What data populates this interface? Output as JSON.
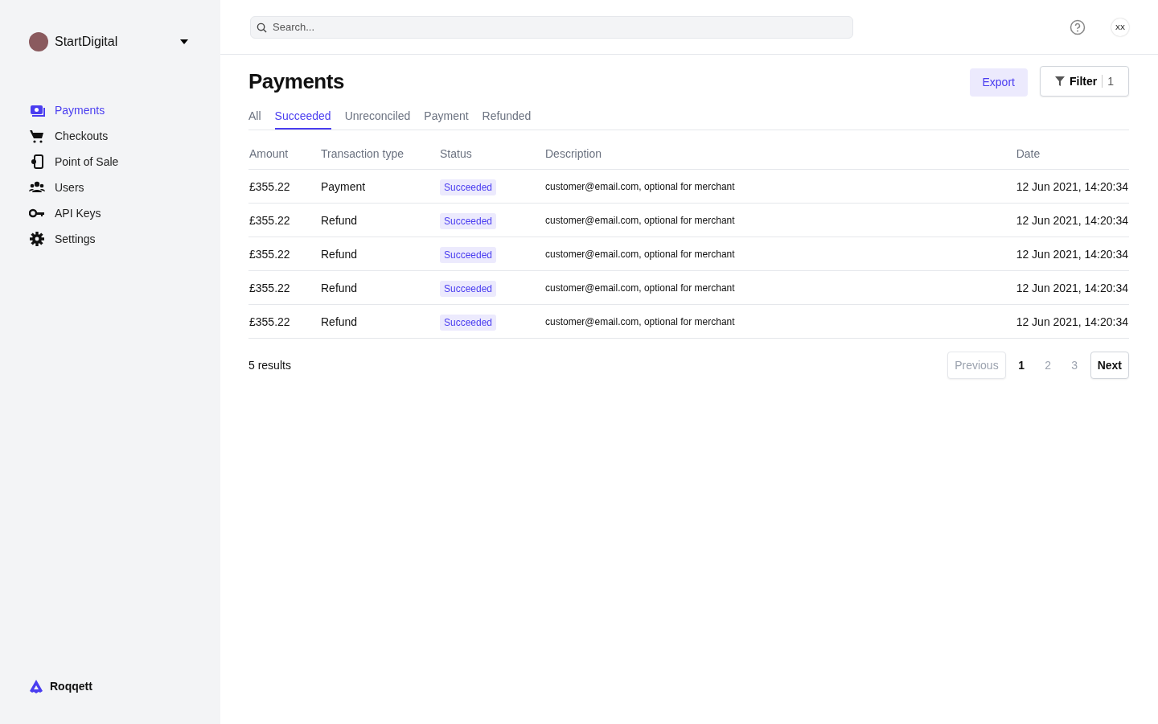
{
  "sidebar": {
    "account": {
      "name": "StartDigital"
    },
    "items": [
      {
        "label": "Payments",
        "selected": true
      },
      {
        "label": "Checkouts",
        "selected": false
      },
      {
        "label": "Point of Sale",
        "selected": false
      },
      {
        "label": "Users",
        "selected": false
      },
      {
        "label": "API Keys",
        "selected": false
      },
      {
        "label": "Settings",
        "selected": false
      }
    ],
    "brand": "Roqqett"
  },
  "topbar": {
    "search": {
      "placeholder": "Search..."
    },
    "user_initials": "XX"
  },
  "page": {
    "title": "Payments",
    "export_button": "Export",
    "filter_button": {
      "label": "Filter",
      "count": "1"
    }
  },
  "tabs": [
    {
      "label": "All",
      "selected": false
    },
    {
      "label": "Succeeded",
      "selected": true
    },
    {
      "label": "Unreconciled",
      "selected": false
    },
    {
      "label": "Payment",
      "selected": false
    },
    {
      "label": "Refunded",
      "selected": false
    }
  ],
  "table": {
    "columns": [
      "Amount",
      "Transaction type",
      "Status",
      "Description",
      "Date"
    ],
    "rows": [
      {
        "amount": "£355.22",
        "type": "Payment",
        "status": "Succeeded",
        "description": "customer@email.com, optional for merchant",
        "date": "12 Jun 2021, 14:20:34"
      },
      {
        "amount": "£355.22",
        "type": "Refund",
        "status": "Succeeded",
        "description": "customer@email.com, optional for merchant",
        "date": "12 Jun 2021, 14:20:34"
      },
      {
        "amount": "£355.22",
        "type": "Refund",
        "status": "Succeeded",
        "description": "customer@email.com, optional for merchant",
        "date": "12 Jun 2021, 14:20:34"
      },
      {
        "amount": "£355.22",
        "type": "Refund",
        "status": "Succeeded",
        "description": "customer@email.com, optional for merchant",
        "date": "12 Jun 2021, 14:20:34"
      },
      {
        "amount": "£355.22",
        "type": "Refund",
        "status": "Succeeded",
        "description": "customer@email.com, optional for merchant",
        "date": "12 Jun 2021, 14:20:34"
      }
    ]
  },
  "footer": {
    "results": "5 results",
    "pagination": {
      "previous": {
        "label": "Previous",
        "disabled": true
      },
      "pages": [
        {
          "label": "1",
          "selected": true
        },
        {
          "label": "2",
          "selected": false
        },
        {
          "label": "3",
          "selected": false
        }
      ],
      "next": {
        "label": "Next",
        "disabled": false
      }
    }
  }
}
